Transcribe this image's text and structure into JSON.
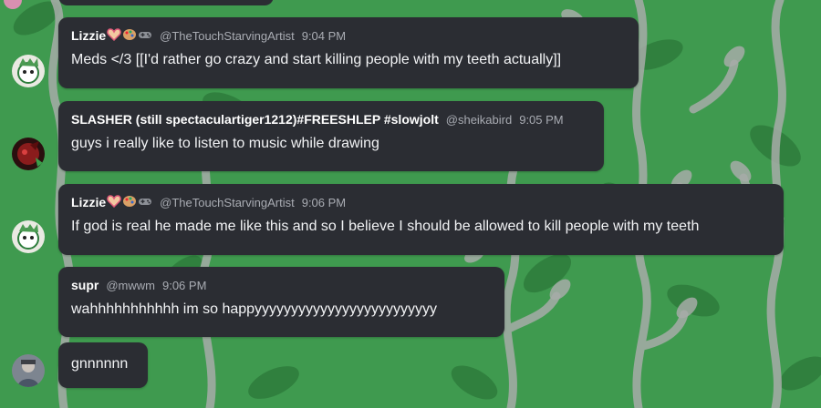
{
  "messages": [
    {
      "author": "Lizzie",
      "badges": [
        "heart-hands-emoji",
        "palette-emoji",
        "game-controller-emoji"
      ],
      "handle": "@TheTouchStarvingArtist",
      "time": "9:04 PM",
      "text": "Meds </3 [[I'd rather go crazy and start killing people with my teeth actually]]"
    },
    {
      "author": "SLASHER (still spectaculartiger1212)#FREESHLEP #slowjolt",
      "handle": "@sheikabird",
      "time": "9:05 PM",
      "text": "guys i really like to listen to music while drawing"
    },
    {
      "author": "Lizzie",
      "badges": [
        "heart-hands-emoji",
        "palette-emoji",
        "game-controller-emoji"
      ],
      "handle": "@TheTouchStarvingArtist",
      "time": "9:06 PM",
      "text": "If god is real he made me like this and so I believe I should be allowed to kill people with my teeth"
    },
    {
      "author": "supr",
      "handle": "@mwwm",
      "time": "9:06 PM",
      "text": "wahhhhhhhhhhh im so happyyyyyyyyyyyyyyyyyyyyyyyyy"
    },
    {
      "text": "gnnnnnn"
    }
  ],
  "colors": {
    "bubble": "#2b2d33",
    "background": "#3f9a4f",
    "leaf_dark": "#2f7d3d",
    "vine": "#a7aca8"
  }
}
